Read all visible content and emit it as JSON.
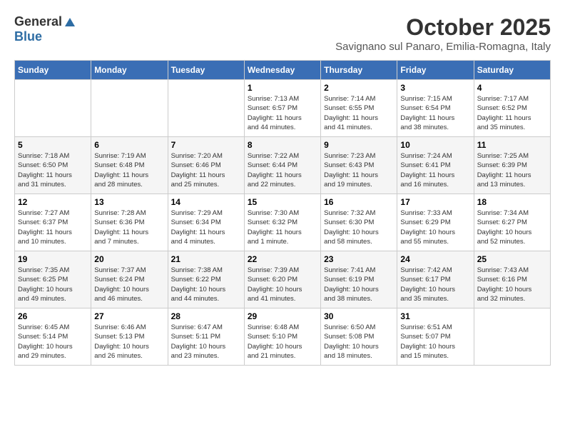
{
  "header": {
    "logo_general": "General",
    "logo_blue": "Blue",
    "month": "October 2025",
    "location": "Savignano sul Panaro, Emilia-Romagna, Italy"
  },
  "weekdays": [
    "Sunday",
    "Monday",
    "Tuesday",
    "Wednesday",
    "Thursday",
    "Friday",
    "Saturday"
  ],
  "weeks": [
    [
      {
        "day": "",
        "info": ""
      },
      {
        "day": "",
        "info": ""
      },
      {
        "day": "",
        "info": ""
      },
      {
        "day": "1",
        "info": "Sunrise: 7:13 AM\nSunset: 6:57 PM\nDaylight: 11 hours\nand 44 minutes."
      },
      {
        "day": "2",
        "info": "Sunrise: 7:14 AM\nSunset: 6:55 PM\nDaylight: 11 hours\nand 41 minutes."
      },
      {
        "day": "3",
        "info": "Sunrise: 7:15 AM\nSunset: 6:54 PM\nDaylight: 11 hours\nand 38 minutes."
      },
      {
        "day": "4",
        "info": "Sunrise: 7:17 AM\nSunset: 6:52 PM\nDaylight: 11 hours\nand 35 minutes."
      }
    ],
    [
      {
        "day": "5",
        "info": "Sunrise: 7:18 AM\nSunset: 6:50 PM\nDaylight: 11 hours\nand 31 minutes."
      },
      {
        "day": "6",
        "info": "Sunrise: 7:19 AM\nSunset: 6:48 PM\nDaylight: 11 hours\nand 28 minutes."
      },
      {
        "day": "7",
        "info": "Sunrise: 7:20 AM\nSunset: 6:46 PM\nDaylight: 11 hours\nand 25 minutes."
      },
      {
        "day": "8",
        "info": "Sunrise: 7:22 AM\nSunset: 6:44 PM\nDaylight: 11 hours\nand 22 minutes."
      },
      {
        "day": "9",
        "info": "Sunrise: 7:23 AM\nSunset: 6:43 PM\nDaylight: 11 hours\nand 19 minutes."
      },
      {
        "day": "10",
        "info": "Sunrise: 7:24 AM\nSunset: 6:41 PM\nDaylight: 11 hours\nand 16 minutes."
      },
      {
        "day": "11",
        "info": "Sunrise: 7:25 AM\nSunset: 6:39 PM\nDaylight: 11 hours\nand 13 minutes."
      }
    ],
    [
      {
        "day": "12",
        "info": "Sunrise: 7:27 AM\nSunset: 6:37 PM\nDaylight: 11 hours\nand 10 minutes."
      },
      {
        "day": "13",
        "info": "Sunrise: 7:28 AM\nSunset: 6:36 PM\nDaylight: 11 hours\nand 7 minutes."
      },
      {
        "day": "14",
        "info": "Sunrise: 7:29 AM\nSunset: 6:34 PM\nDaylight: 11 hours\nand 4 minutes."
      },
      {
        "day": "15",
        "info": "Sunrise: 7:30 AM\nSunset: 6:32 PM\nDaylight: 11 hours\nand 1 minute."
      },
      {
        "day": "16",
        "info": "Sunrise: 7:32 AM\nSunset: 6:30 PM\nDaylight: 10 hours\nand 58 minutes."
      },
      {
        "day": "17",
        "info": "Sunrise: 7:33 AM\nSunset: 6:29 PM\nDaylight: 10 hours\nand 55 minutes."
      },
      {
        "day": "18",
        "info": "Sunrise: 7:34 AM\nSunset: 6:27 PM\nDaylight: 10 hours\nand 52 minutes."
      }
    ],
    [
      {
        "day": "19",
        "info": "Sunrise: 7:35 AM\nSunset: 6:25 PM\nDaylight: 10 hours\nand 49 minutes."
      },
      {
        "day": "20",
        "info": "Sunrise: 7:37 AM\nSunset: 6:24 PM\nDaylight: 10 hours\nand 46 minutes."
      },
      {
        "day": "21",
        "info": "Sunrise: 7:38 AM\nSunset: 6:22 PM\nDaylight: 10 hours\nand 44 minutes."
      },
      {
        "day": "22",
        "info": "Sunrise: 7:39 AM\nSunset: 6:20 PM\nDaylight: 10 hours\nand 41 minutes."
      },
      {
        "day": "23",
        "info": "Sunrise: 7:41 AM\nSunset: 6:19 PM\nDaylight: 10 hours\nand 38 minutes."
      },
      {
        "day": "24",
        "info": "Sunrise: 7:42 AM\nSunset: 6:17 PM\nDaylight: 10 hours\nand 35 minutes."
      },
      {
        "day": "25",
        "info": "Sunrise: 7:43 AM\nSunset: 6:16 PM\nDaylight: 10 hours\nand 32 minutes."
      }
    ],
    [
      {
        "day": "26",
        "info": "Sunrise: 6:45 AM\nSunset: 5:14 PM\nDaylight: 10 hours\nand 29 minutes."
      },
      {
        "day": "27",
        "info": "Sunrise: 6:46 AM\nSunset: 5:13 PM\nDaylight: 10 hours\nand 26 minutes."
      },
      {
        "day": "28",
        "info": "Sunrise: 6:47 AM\nSunset: 5:11 PM\nDaylight: 10 hours\nand 23 minutes."
      },
      {
        "day": "29",
        "info": "Sunrise: 6:48 AM\nSunset: 5:10 PM\nDaylight: 10 hours\nand 21 minutes."
      },
      {
        "day": "30",
        "info": "Sunrise: 6:50 AM\nSunset: 5:08 PM\nDaylight: 10 hours\nand 18 minutes."
      },
      {
        "day": "31",
        "info": "Sunrise: 6:51 AM\nSunset: 5:07 PM\nDaylight: 10 hours\nand 15 minutes."
      },
      {
        "day": "",
        "info": ""
      }
    ]
  ]
}
